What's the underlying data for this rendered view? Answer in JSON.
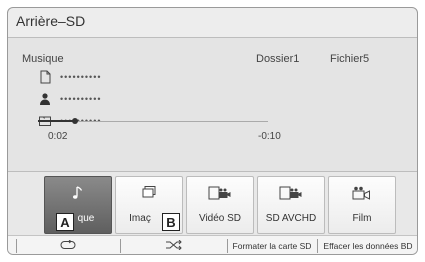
{
  "header": {
    "title": "Arrière–SD"
  },
  "track": {
    "source_label": "Musique",
    "folder_label": "Dossier1",
    "file_label": "Fichier5",
    "rows": [
      {
        "icon": "file-icon",
        "value": "••••••••••"
      },
      {
        "icon": "artist-icon",
        "value": "••••••••••"
      },
      {
        "icon": "album-icon",
        "value": "••••••••••"
      }
    ]
  },
  "playback": {
    "elapsed": "0:02",
    "remaining": "-0:10",
    "progress": 0.16
  },
  "sources": [
    {
      "label": "Musique",
      "display": "que",
      "icon": "music-note-icon",
      "active": true
    },
    {
      "label": "Images",
      "display": "Imaç",
      "icon": "image-icon",
      "active": false
    },
    {
      "label": "Vidéo SD",
      "display": "Vidéo SD",
      "icon": "video-sd-icon",
      "active": false
    },
    {
      "label": "SD AVCHD",
      "display": "SD AVCHD",
      "icon": "avchd-icon",
      "active": false
    },
    {
      "label": "Film",
      "display": "Film",
      "icon": "film-icon",
      "active": false
    }
  ],
  "callouts": {
    "a": "A",
    "b": "B"
  },
  "bottom_bar": {
    "repeat_icon": "repeat-icon",
    "shuffle_icon": "shuffle-icon",
    "format_label": "Formater la carte SD",
    "erase_label": "Effacer les données BD"
  },
  "colors": {
    "active_button": "#6e6e6e",
    "panel": "#e4e4e4"
  }
}
